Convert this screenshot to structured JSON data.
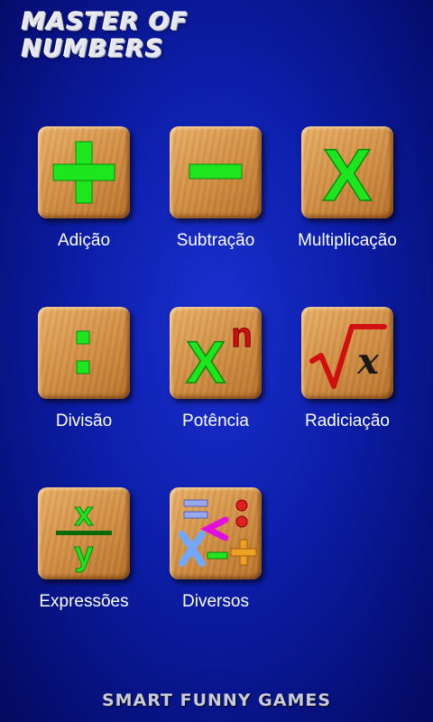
{
  "app": {
    "title_line1": "MASTER OF",
    "title_line2": "NUMBERS"
  },
  "menu": [
    {
      "label": "Adição",
      "icon": "plus-icon"
    },
    {
      "label": "Subtração",
      "icon": "minus-icon"
    },
    {
      "label": "Multiplicação",
      "icon": "times-icon"
    },
    {
      "label": "Divisão",
      "icon": "colon-icon"
    },
    {
      "label": "Potência",
      "icon": "power-icon"
    },
    {
      "label": "Radiciação",
      "icon": "root-icon"
    },
    {
      "label": "Expressões",
      "icon": "fraction-icon"
    },
    {
      "label": "Diversos",
      "icon": "mixed-symbols-icon"
    }
  ],
  "icon_text": {
    "times": "X",
    "power_base": "X",
    "power_exp": "n",
    "root_var": "x",
    "frac_num": "x",
    "frac_den": "y"
  },
  "footer": "SMART FUNNY GAMES",
  "colors": {
    "accent_green": "#1ee61e",
    "accent_red": "#d01010",
    "wood": "#d4934a",
    "background": "#0c1ea8"
  }
}
